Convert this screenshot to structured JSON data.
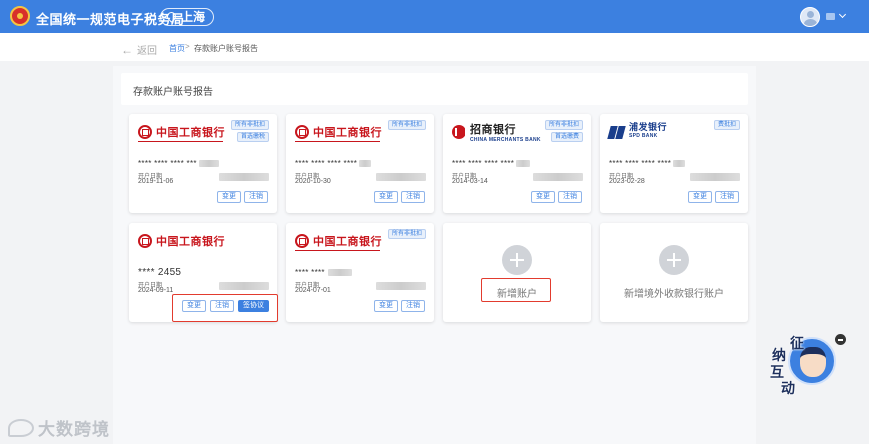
{
  "header": {
    "title": "全国统一规范电子税务局",
    "region": "上海"
  },
  "breadcrumb": {
    "back": "返回",
    "home": "首页",
    "separator": ">",
    "current": "存款账户账号报告"
  },
  "section": {
    "title": "存款账户账号报告"
  },
  "cards": [
    {
      "bank": "中国工商银行",
      "tags": [
        "所有非批扣",
        "首选缴税"
      ],
      "account": "**** **** **** ***",
      "date_label": "开户日期",
      "date": "2019-11-06",
      "buttons": [
        "变更",
        "注销"
      ]
    },
    {
      "bank": "中国工商银行",
      "tags": [
        "所有非批扣"
      ],
      "account": "**** **** **** ****",
      "date_label": "开户日期",
      "date": "2020-10-30",
      "buttons": [
        "变更",
        "注销"
      ]
    },
    {
      "bank": "招商银行",
      "bank_sub": "CHINA MERCHANTS BANK",
      "tags": [
        "所有非批扣",
        "首选缴费"
      ],
      "account": "**** **** **** ****",
      "date_label": "开户日期",
      "date": "2014-03-14",
      "buttons": [
        "变更",
        "注销"
      ]
    },
    {
      "bank": "浦发银行",
      "bank_sub": "SPD BANK",
      "tags": [
        "费批扣"
      ],
      "account": "**** **** **** ****",
      "date_label": "开户日期",
      "date": "2023-02-28",
      "buttons": [
        "变更",
        "注销"
      ]
    },
    {
      "bank": "中国工商银行",
      "tags": [],
      "account": "**** 2455",
      "date_label": "开户日期",
      "date": "2024-09-11",
      "buttons": [
        "变更",
        "注销",
        "签协议"
      ]
    },
    {
      "bank": "中国工商银行",
      "tags": [
        "所有非批扣"
      ],
      "account": "**** ****",
      "date_label": "开户日期",
      "date": "2024-07-01",
      "buttons": [
        "变更",
        "注销"
      ]
    }
  ],
  "add_cards": {
    "new_account": "新增账户",
    "new_foreign": "新增境外收款银行账户"
  },
  "mascot": {
    "chars": [
      "征",
      "纳",
      "互",
      "动"
    ]
  },
  "watermark": "大数跨境",
  "colors": {
    "primary": "#3c80e0",
    "icbc_red": "#c8161d",
    "highlight": "#e23b2e"
  }
}
